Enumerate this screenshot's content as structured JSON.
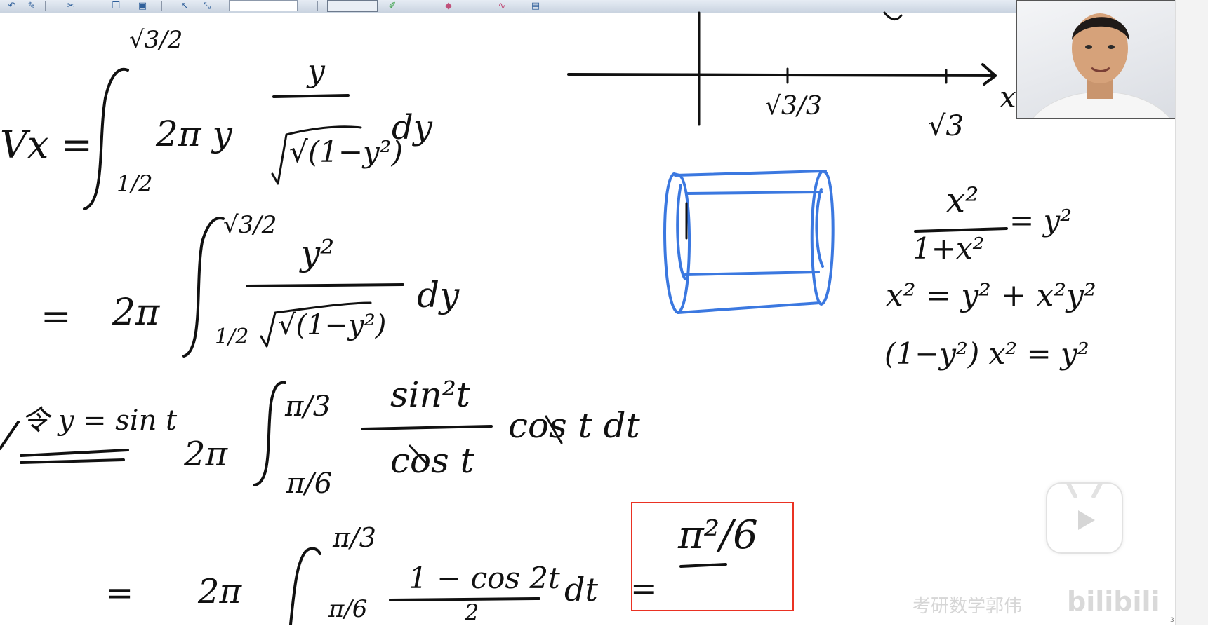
{
  "board": {
    "vx_label": "Vx =",
    "int1_upper": "√3/2",
    "int1_lower": "1/2",
    "int1_body": "2π y",
    "frac1_num": "y",
    "frac1_den": "√(1−y²)",
    "int1_dy": "dy",
    "line2_eq": "=",
    "line2_coef": "2π",
    "int2_upper": "√3/2",
    "int2_lower": "1/2",
    "frac2_num": "y²",
    "frac2_den": "√(1−y²)",
    "int2_dy": "dy",
    "sub_note": "令 y = sin t",
    "line3_coef": "2π",
    "int3_upper": "π/3",
    "int3_lower": "π/6",
    "frac3_num": "sin²t",
    "frac3_den": "cos t",
    "line3_tail": "cos t dt",
    "line4_eq": "=",
    "line4_coef": "2π",
    "int4_upper": "π/3",
    "int4_lower": "π/6",
    "frac4_num": "1 − cos 2t",
    "frac4_den": "2",
    "line4_dt": "dt",
    "line4_eq2": "=",
    "answer": "π²/6",
    "axis_x_label": "x",
    "tick1": "√3/3",
    "tick2": "√3",
    "side1_num": "x²",
    "side1_den": "1+x²",
    "side1_rhs": "= y²",
    "side2": "x² = y² + x²y²",
    "side3": "(1−y²) x² = y²"
  },
  "overlay": {
    "watermark": "考研数学郭伟",
    "logo": "bilibili",
    "page_number": "3"
  },
  "colors": {
    "ink": "#111111",
    "blue_ink": "#3b78e0",
    "highlight_box": "#ea3223"
  }
}
